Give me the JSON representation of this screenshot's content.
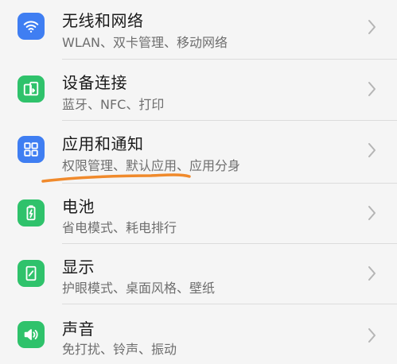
{
  "settings": {
    "items": [
      {
        "icon": "wifi-icon",
        "title": "无线和网络",
        "subtitle": "WLAN、双卡管理、移动网络",
        "color": "#3f7ef2"
      },
      {
        "icon": "device-connection-icon",
        "title": "设备连接",
        "subtitle": "蓝牙、NFC、打印",
        "color": "#2fc26b"
      },
      {
        "icon": "apps-grid-icon",
        "title": "应用和通知",
        "subtitle": "权限管理、默认应用、应用分身",
        "color": "#3f7ef2"
      },
      {
        "icon": "battery-icon",
        "title": "电池",
        "subtitle": "省电模式、耗电排行",
        "color": "#2fc26b"
      },
      {
        "icon": "display-icon",
        "title": "显示",
        "subtitle": "护眼模式、桌面风格、壁纸",
        "color": "#2fc26b"
      },
      {
        "icon": "sound-icon",
        "title": "声音",
        "subtitle": "免打扰、铃声、振动",
        "color": "#2fc26b"
      }
    ]
  },
  "annotation": {
    "color": "#f08a2c"
  }
}
